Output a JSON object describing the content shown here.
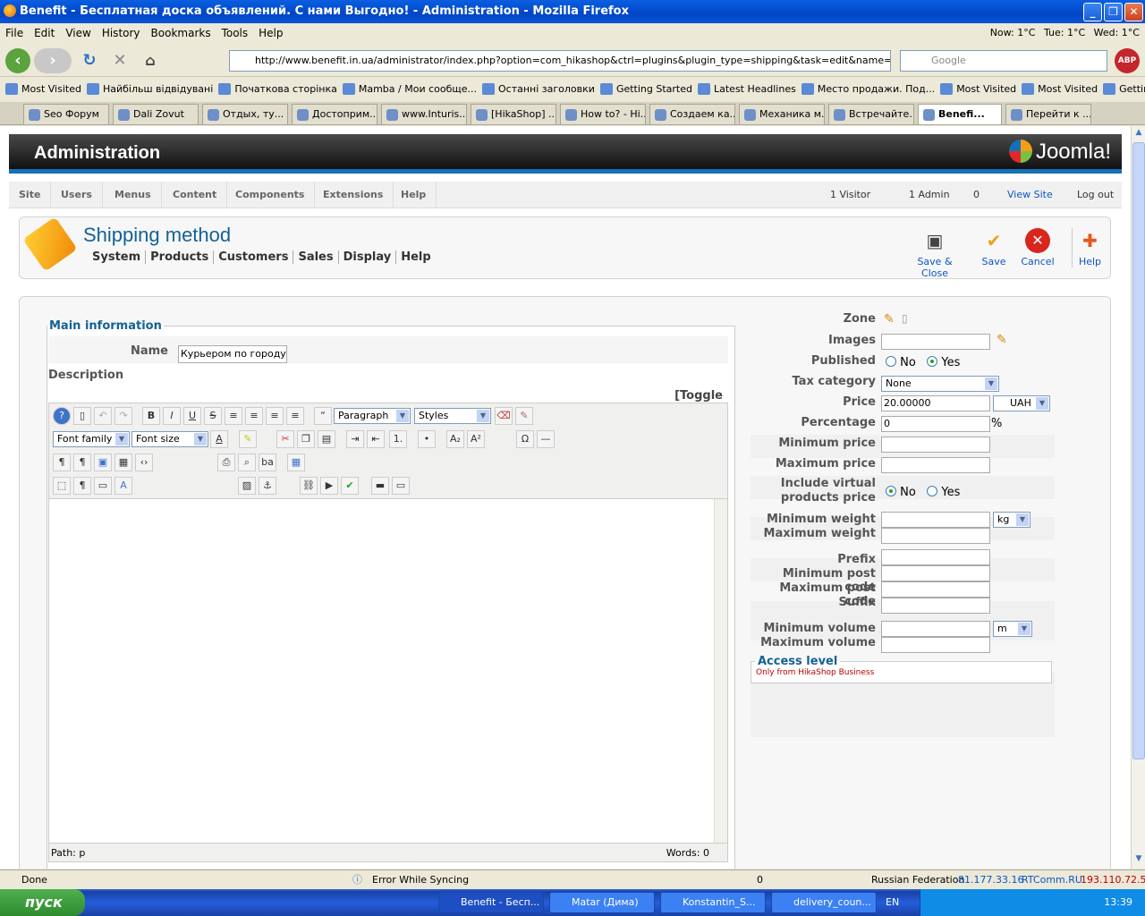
{
  "window": {
    "title": "Benefit - Бесплатная доска объявлений. С нами Выгодно! - Administration - Mozilla Firefox"
  },
  "menu": [
    "File",
    "Edit",
    "View",
    "History",
    "Bookmarks",
    "Tools",
    "Help"
  ],
  "weather": {
    "now": "Now: 1°C",
    "tue": "Tue: 1°C",
    "wed": "Wed: 1°C"
  },
  "nav": {
    "url": "http://www.benefit.in.ua/administrator/index.php?option=com_hikashop&ctrl=plugins&plugin_type=shipping&task=edit&name=manual&su",
    "search_placeholder": "Google"
  },
  "bookmarks": [
    "Most Visited",
    "Найбільш відвідувані",
    "Початкова сторінка",
    "Mamba / Мои сообще...",
    "Останні заголовки",
    "Getting Started",
    "Latest Headlines",
    "Место продажи. Под...",
    "Most Visited",
    "Most Visited",
    "Getting Started"
  ],
  "tabs": [
    "Seo Форум",
    "Dali Zovut",
    "Отдых, ту...",
    "Достоприм...",
    "www.Inturis...",
    "[HikaShop] ...",
    "How to? - Hi...",
    "Создаем ка...",
    "Механика м...",
    "Встречайте...",
    "Benefi...",
    "Перейти к ..."
  ],
  "admin": {
    "title": "Administration",
    "brand": "Joomla!",
    "menu": [
      "Site",
      "Users",
      "Menus",
      "Content",
      "Components",
      "Extensions",
      "Help"
    ],
    "status": {
      "visitors": "1 Visitor",
      "admins": "1 Admin",
      "messages": "0",
      "view_site": "View Site",
      "logout": "Log out"
    }
  },
  "page": {
    "title": "Shipping method",
    "submenu": [
      "System",
      "Products",
      "Customers",
      "Sales",
      "Display",
      "Help"
    ],
    "toolbar": {
      "save_close": "Save & Close",
      "save": "Save",
      "cancel": "Cancel",
      "help": "Help"
    }
  },
  "form": {
    "legend": "Main information",
    "name_label": "Name",
    "name_value": "Курьером по городу",
    "desc_label": "Description",
    "toggle": "[Toggle Editor]",
    "editor": {
      "format": "Paragraph",
      "styles": "Styles",
      "font_family": "Font family",
      "font_size": "Font size",
      "path": "Path:",
      "path_value": "p",
      "words": "Words: 0"
    },
    "right": {
      "zone": "Zone",
      "images": "Images",
      "published": "Published",
      "no": "No",
      "yes": "Yes",
      "tax": "Tax category",
      "tax_value": "None",
      "price": "Price",
      "price_value": "20.00000",
      "currency": "UAH",
      "percentage": "Percentage",
      "percentage_value": "0",
      "percent_sign": "%",
      "min_price": "Minimum price",
      "max_price": "Maximum price",
      "include_virtual_1": "Include virtual",
      "include_virtual_2": "products price",
      "min_weight": "Minimum weight",
      "max_weight": "Maximum weight",
      "weight_unit": "kg",
      "prefix": "Prefix",
      "min_post": "Minimum post code",
      "max_post": "Maximum post code",
      "suffix": "Suffix",
      "min_volume": "Minimum volume",
      "max_volume": "Maximum volume",
      "volume_unit": "m",
      "access_legend": "Access level",
      "access_note": "Only from HikaShop Business"
    }
  },
  "status": {
    "done": "Done",
    "sync": "Error While Syncing",
    "count": "0",
    "country": "Russian Federation",
    "ip": "81.177.33.16",
    "isp": "RTComm.RU",
    "ip2": "193.110.72.5"
  },
  "taskbar": {
    "start": "пуск",
    "tasks": [
      "Benefit - Бесп...",
      "Matar (Дима)",
      "Konstantin_S...",
      "delivery_coun..."
    ],
    "lang": "EN",
    "time": "13:39"
  }
}
